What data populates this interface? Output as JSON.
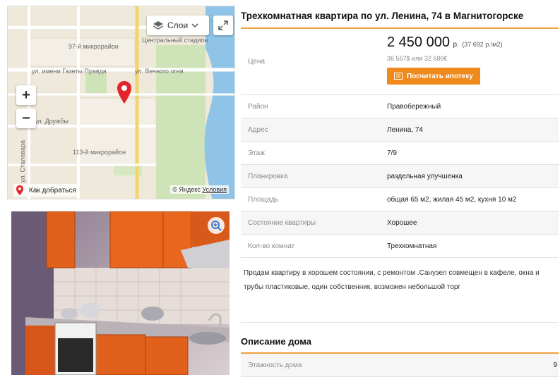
{
  "map": {
    "layers_label": "Слои",
    "zoom_in": "+",
    "zoom_out": "−",
    "route_label": "Как добраться",
    "copyright_prefix": "© Яндекс",
    "terms_link": "Условия",
    "labels": {
      "district_97": "97-й микрорайон",
      "stadium": "Центральный стадион",
      "gazety_pravda": "ул. имени Газеты Правда",
      "vechnogo": "ул. Вечного огня",
      "druzhby": "ул. Дружбы",
      "district_113": "113-й микрорайон",
      "vert_street": "ул. Сталевара"
    }
  },
  "listing": {
    "title": "Трехкомнатная квартира по ул. Ленина, 74 в Магнитогорске",
    "price_label": "Цена",
    "price_value": "2 450 000",
    "price_unit": "р.",
    "price_per_sqm": "(37 692 р./м2)",
    "price_alt": "36 567$ или 32 686€",
    "calc_button": "Посчитать ипотеку",
    "rows": [
      {
        "key": "Район",
        "value": "Правобережный"
      },
      {
        "key": "Адрес",
        "value": "Ленина, 74"
      },
      {
        "key": "Этаж",
        "value": "7/9"
      },
      {
        "key": "Планировка",
        "value": "раздельная улучшенка"
      },
      {
        "key": "Площадь",
        "value": "общая 65 м2, жилая 45 м2, кухня 10 м2"
      },
      {
        "key": "Состояние квартиры",
        "value": "Хорошее"
      },
      {
        "key": "Кол-во комнат",
        "value": "Трехкомнатная"
      }
    ],
    "description": "Продам квартиру в хорошем состоянии, с ремонтом .Санузел совмещен в кафеле, окна и трубы пластиковые, один собственник, возможен небольшой торг"
  },
  "house": {
    "title": "Описание дома",
    "rows": [
      {
        "key": "Этажность дома",
        "value": "9"
      }
    ]
  },
  "colors": {
    "accent": "#f29f3d",
    "button": "#f08a1c",
    "pin": "#e3242b",
    "water": "#8fc4e8"
  }
}
